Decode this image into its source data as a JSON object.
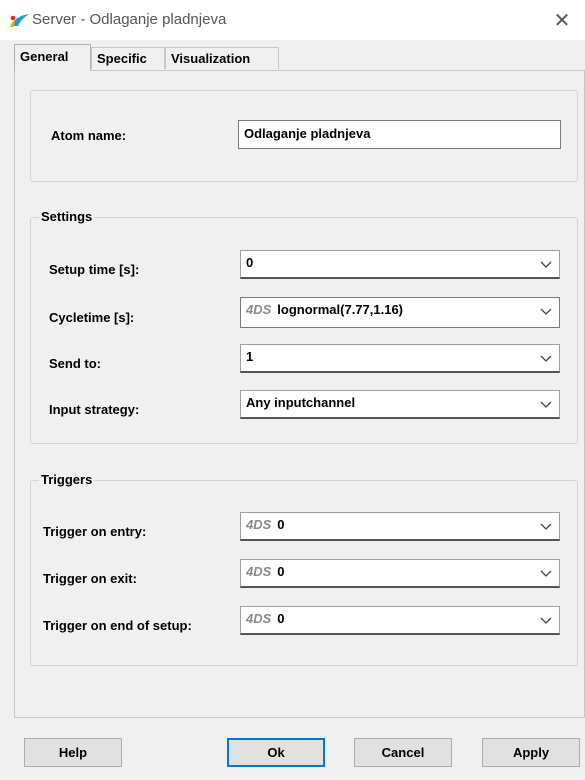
{
  "window": {
    "title": "Server - Odlaganje pladnjeva",
    "close_symbol": "✕",
    "accent": "#0078d7"
  },
  "tabs": [
    "General",
    "Specific",
    "Visualization"
  ],
  "general": {
    "atom_name_label": "Atom name:",
    "atom_name_value": "Odlaganje pladnjeva"
  },
  "settings": {
    "title": "Settings",
    "setup_time_label": "Setup time [s]:",
    "setup_time_value": "0",
    "cycletime_label": "Cycletime [s]:",
    "cycletime_tag": "4DS",
    "cycletime_value": "lognormal(7.77,1.16)",
    "send_to_label": "Send to:",
    "send_to_value": "1",
    "input_strategy_label": "Input strategy:",
    "input_strategy_value": "Any inputchannel"
  },
  "triggers": {
    "title": "Triggers",
    "on_entry_label": "Trigger on entry:",
    "on_entry_tag": "4DS",
    "on_entry_value": "0",
    "on_exit_label": "Trigger on exit:",
    "on_exit_tag": "4DS",
    "on_exit_value": "0",
    "on_end_setup_label": "Trigger on end of setup:",
    "on_end_setup_tag": "4DS",
    "on_end_setup_value": "0"
  },
  "buttons": {
    "help": "Help",
    "ok": "Ok",
    "cancel": "Cancel",
    "apply": "Apply"
  }
}
